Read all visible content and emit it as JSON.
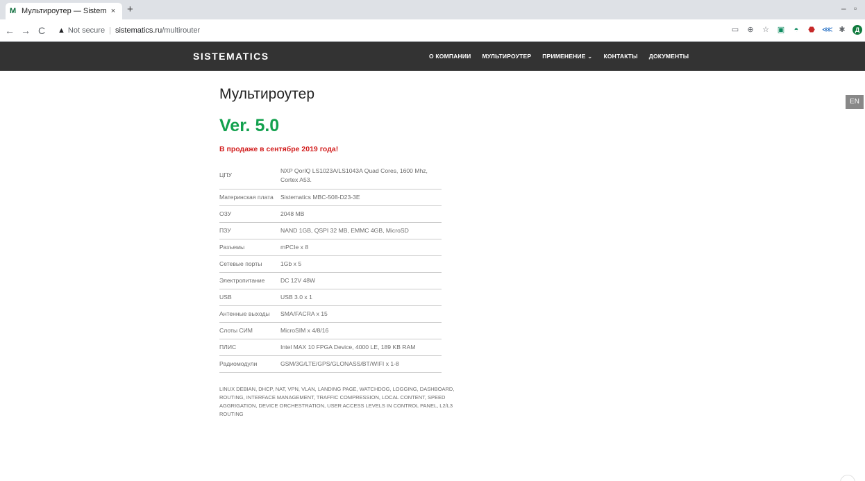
{
  "browser": {
    "tab_title": "Мультироутер — Sistem",
    "tab_favicon": "M",
    "tab_close": "×",
    "new_tab": "+",
    "minimize": "–",
    "restore": "▫",
    "not_secure": "Not secure",
    "url_host": "sistematics.ru",
    "url_path": "/multirouter",
    "extensions": [
      "reader-icon",
      "zoom-icon",
      "star-icon",
      "cast-icon",
      "ext-green-icon",
      "shield-icon",
      "ext-blue-icon",
      "puzzle-icon",
      "profile-avatar"
    ],
    "avatar_letter": "Д"
  },
  "site": {
    "logo": "SISTEMATICS",
    "menu": [
      "О КОМПАНИИ",
      "МУЛЬТИРОУТЕР",
      "ПРИМЕНЕНИЕ ⌄",
      "КОНТАКТЫ",
      "ДОКУМЕНТЫ"
    ],
    "lang": "EN"
  },
  "page": {
    "title": "Мультироутер",
    "version": "Ver. 5.0",
    "sale_note": "В продаже в сентябре 2019 года!",
    "specs": [
      {
        "k": "ЦПУ",
        "v": "NXP QorIQ LS1023A/LS1043A Quad Cores, 1600 Mhz, Cortex A53."
      },
      {
        "k": "Материнская плата",
        "v": "Sistematics MBC-508-D23-3E"
      },
      {
        "k": "ОЗУ",
        "v": "2048 MB"
      },
      {
        "k": "ПЗУ",
        "v": "NAND 1GB, QSPI 32 MB, EMMC 4GB, MicroSD"
      },
      {
        "k": "Разъемы",
        "v": "mPCIe x 8"
      },
      {
        "k": "Сетевые порты",
        "v": "1Gb x 5"
      },
      {
        "k": "Электропитание",
        "v": "DC 12V 48W"
      },
      {
        "k": "USB",
        "v": "USB 3.0 x 1"
      },
      {
        "k": "Антенные выходы",
        "v": "SMA/FACRA x 15"
      },
      {
        "k": "Слоты СИМ",
        "v": "MicroSIM x 4/8/16"
      },
      {
        "k": "ПЛИС",
        "v": "Intel MAX 10 FPGA Device, 4000 LE, 189 KB RAM"
      },
      {
        "k": "Радиомодули",
        "v": "GSM/3G/LTE/GPS/GLONASS/BT/WIFI x 1-8"
      }
    ],
    "features": "LINUX DEBIAN, DHCP, NAT, VPN, VLAN, LANDING PAGE, WATCHDOG, LOGGING, DASHBOARD, ROUTING, INTERFACE MANAGEMENT, TRAFFIC COMPRESSION, LOCAL CONTENT, SPEED AGGRIGATION, DEVICE ORCHESTRATION, USER ACCESS LEVELS IN CONTROL PANEL, L2/L3 ROUTING"
  },
  "colors": {
    "header_bg": "#333333",
    "version_green": "#13a14e",
    "sale_red": "#d21d1d"
  }
}
